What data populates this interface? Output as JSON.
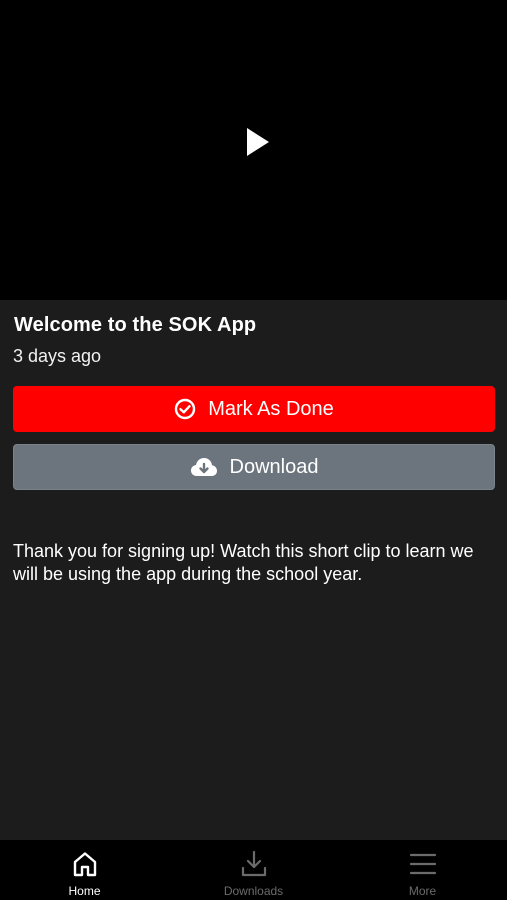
{
  "video": {
    "play_icon": "play-icon"
  },
  "post": {
    "title": "Welcome to the SOK App",
    "age": "3 days ago",
    "mark_done_label": "Mark As Done",
    "download_label": "Download",
    "description": "Thank you for signing up! Watch this short clip to learn we will be using the app during the school year."
  },
  "tabs": [
    {
      "label": "Home",
      "icon": "home-icon",
      "active": true
    },
    {
      "label": "Downloads",
      "icon": "download-icon",
      "active": false
    },
    {
      "label": "More",
      "icon": "menu-icon",
      "active": false
    }
  ],
  "colors": {
    "background": "#1c1c1c",
    "video": "#000000",
    "mark_done": "#ff0000",
    "download": "#6c757d",
    "tab_active": "#ffffff",
    "tab_inactive": "#6b6b6b"
  }
}
